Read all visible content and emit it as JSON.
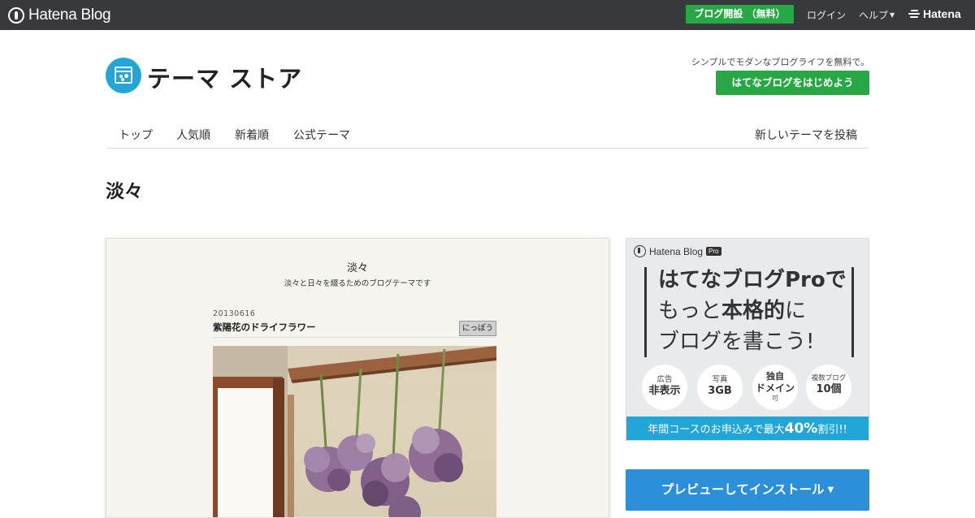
{
  "global_header": {
    "logo_text": "Hatena Blog",
    "cta_label": "ブログ開設 （無料）",
    "login_label": "ログイン",
    "help_label": "ヘルプ",
    "hatena_label": "Hatena"
  },
  "store": {
    "title": "テーマ ストア",
    "tagline": "シンプルでモダンなブログライフを無料で。",
    "start_button": "はてなブログをはじめよう"
  },
  "nav": {
    "items": [
      "トップ",
      "人気順",
      "新着順",
      "公式テーマ"
    ],
    "post_link": "新しいテーマを投稿"
  },
  "theme": {
    "name": "淡々"
  },
  "preview": {
    "blog_title": "淡々",
    "blog_description": "淡々と日々を綴るためのブログテーマです",
    "entry_date": "20130616",
    "entry_title": "紫陽花のドライフラワー",
    "entry_tag": "にっぽう"
  },
  "ad": {
    "brand": "Hatena Blog",
    "brand_badge": "Pro",
    "line1": "はてなブログProで",
    "line2_pre": "もっと",
    "line2_emph": "本格的",
    "line2_post": "に",
    "line3": "ブログを書こう!",
    "features": [
      {
        "small": "広告",
        "large": "非表示",
        "sub": ""
      },
      {
        "small": "写真",
        "large": "3GB",
        "sub": ""
      },
      {
        "small": "独自",
        "large": "ドメイン",
        "sub": "可"
      },
      {
        "small": "複数ブログ",
        "large": "10個",
        "sub": ""
      }
    ],
    "footer_pre": "年間コースのお申込みで最大",
    "footer_emph": "40%",
    "footer_post": "割引!!",
    "colors": {
      "footer": "#22a6d8",
      "highlight": "#f5e12a"
    }
  },
  "install_button": {
    "label": "プレビューしてインストール",
    "caret": "▼"
  },
  "colors": {
    "header_bg": "#38393d",
    "green": "#27a844",
    "blue": "#2b8fd9",
    "logo_blue": "#22a6d8"
  }
}
